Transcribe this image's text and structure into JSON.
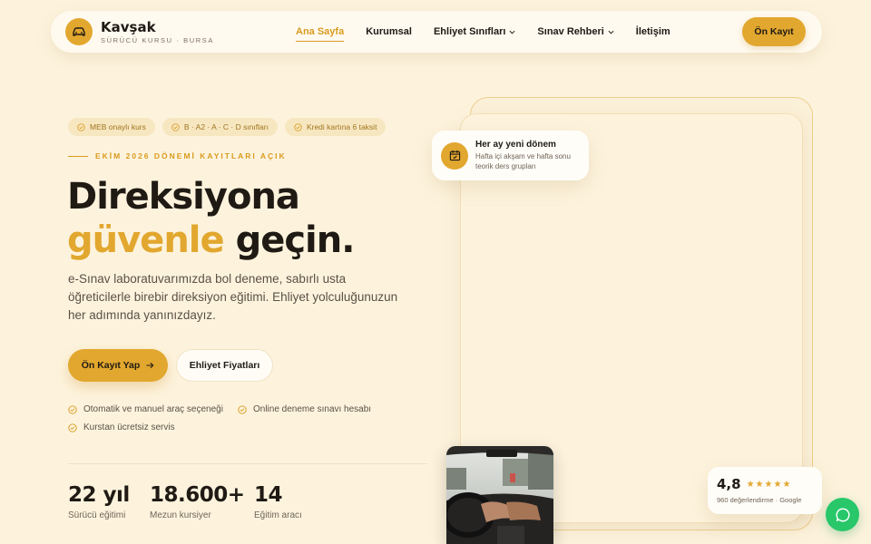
{
  "nav": {
    "brand_name": "Kavşak",
    "brand_sub": "SÜRÜCÜ KURSU · BURSA",
    "items": [
      {
        "label": "Ana Sayfa",
        "active": true
      },
      {
        "label": "Kurumsal"
      },
      {
        "label": "Ehliyet Sınıfları",
        "dropdown": true
      },
      {
        "label": "Sınav Rehberi",
        "dropdown": true
      },
      {
        "label": "İletişim"
      }
    ],
    "cta": "Ön Kayıt"
  },
  "hero": {
    "chips": [
      "MEB onaylı kurs",
      "B · A2 · A · C · D sınıfları",
      "Kredi kartına 6 taksit"
    ],
    "eyebrow": "EKİM 2026 DÖNEMİ KAYITLARI AÇIK",
    "headline_line1": "Direksiyona",
    "headline_gold": "güvenle",
    "headline_rest": "geçin.",
    "lead": "e-Sınav laboratuvarımızda bol deneme, sabırlı usta öğreticilerle birebir direksiyon eğitimi. Ehliyet yolculuğunuzun her adımında yanınızdayız.",
    "primary_button": "Ön Kayıt Yap",
    "secondary_button": "Ehliyet Fiyatları",
    "features": [
      "Otomatik ve manuel araç seçeneği",
      "Online deneme sınavı hesabı",
      "Kurstan ücretsiz servis"
    ],
    "stats": [
      {
        "value": "22 yıl",
        "label": "Sürücü eğitimi"
      },
      {
        "value": "18.600+",
        "label": "Mezun kursiyer"
      },
      {
        "value": "14",
        "label": "Eğitim aracı"
      }
    ]
  },
  "float_card": {
    "title": "Her ay yeni dönem",
    "text": "Hafta içi akşam ve hafta sonu teorik ders grupları"
  },
  "rating": {
    "score": "4,8",
    "stars": "★★★★★",
    "sub": "960 değerlendirme · Google"
  },
  "colors": {
    "accent": "#e2a72e",
    "background": "#fdf3dd",
    "chat": "#28c76a"
  }
}
